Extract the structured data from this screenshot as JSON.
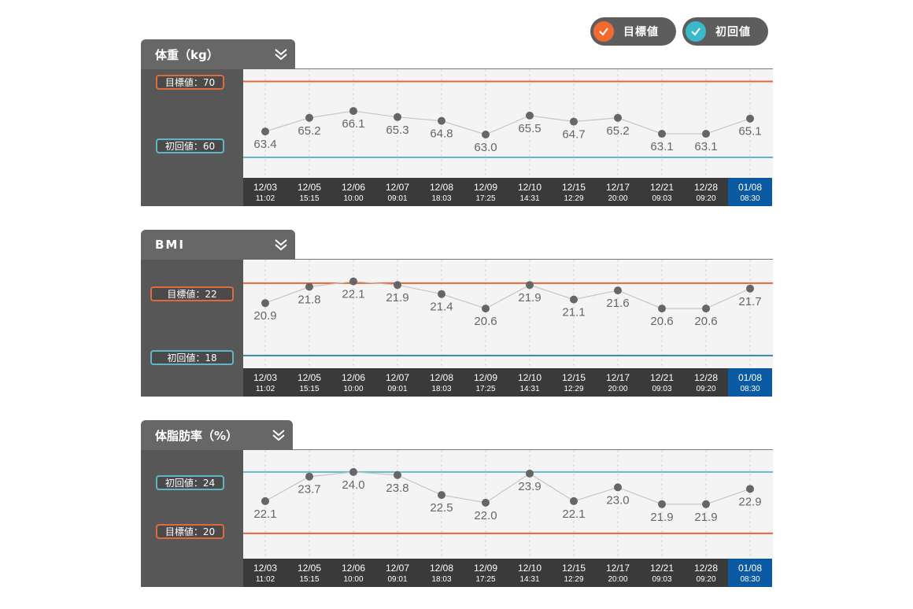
{
  "toggles": {
    "target": {
      "label": "目標値",
      "color": "#f26a30"
    },
    "initial": {
      "label": "初回値",
      "color": "#39b9c9"
    }
  },
  "x_ticks": [
    {
      "date": "12/03",
      "time": "11:02"
    },
    {
      "date": "12/05",
      "time": "15:15"
    },
    {
      "date": "12/06",
      "time": "10:00"
    },
    {
      "date": "12/07",
      "time": "09:01"
    },
    {
      "date": "12/08",
      "time": "18:03"
    },
    {
      "date": "12/09",
      "time": "17:25"
    },
    {
      "date": "12/10",
      "time": "14:31"
    },
    {
      "date": "12/15",
      "time": "12:29"
    },
    {
      "date": "12/17",
      "time": "20:00"
    },
    {
      "date": "12/21",
      "time": "09:03"
    },
    {
      "date": "12/28",
      "time": "09:20"
    },
    {
      "date": "01/08",
      "time": "08:30"
    }
  ],
  "chart_data": [
    {
      "type": "line",
      "title": "体重（kg）",
      "values": [
        63.4,
        65.2,
        66.1,
        65.3,
        64.8,
        63.0,
        65.5,
        64.7,
        65.2,
        63.1,
        63.1,
        65.1
      ],
      "target": {
        "label": "目標値：70",
        "value": 70
      },
      "initial": {
        "label": "初回値：60",
        "value": 60
      },
      "ylim": [
        57.3,
        71.6
      ]
    },
    {
      "type": "line",
      "title": "BMI",
      "values": [
        20.9,
        21.8,
        22.1,
        21.9,
        21.4,
        20.6,
        21.9,
        21.1,
        21.6,
        20.6,
        20.6,
        21.7
      ],
      "target": {
        "label": "目標値：22",
        "value": 22
      },
      "initial": {
        "label": "初回値：18",
        "value": 18
      },
      "ylim": [
        17.3,
        23.3
      ]
    },
    {
      "type": "line",
      "title": "体脂肪率（%）",
      "values": [
        22.1,
        23.7,
        24.0,
        23.8,
        22.5,
        22.0,
        23.9,
        22.1,
        23.0,
        21.9,
        21.9,
        22.9
      ],
      "target": {
        "label": "目標値：20",
        "value": 20
      },
      "initial": {
        "label": "初回値：24",
        "value": 24
      },
      "ylim": [
        18.35,
        25.43
      ]
    }
  ],
  "colors": {
    "target_line": "#e2683a",
    "initial_line_weight": "#5fb7c6",
    "initial_line_bmi": "#3c87a8",
    "initial_line_fat": "#6ab9c8",
    "highlight": "#0a59a3",
    "axis_dark": "#3a3a3a"
  }
}
